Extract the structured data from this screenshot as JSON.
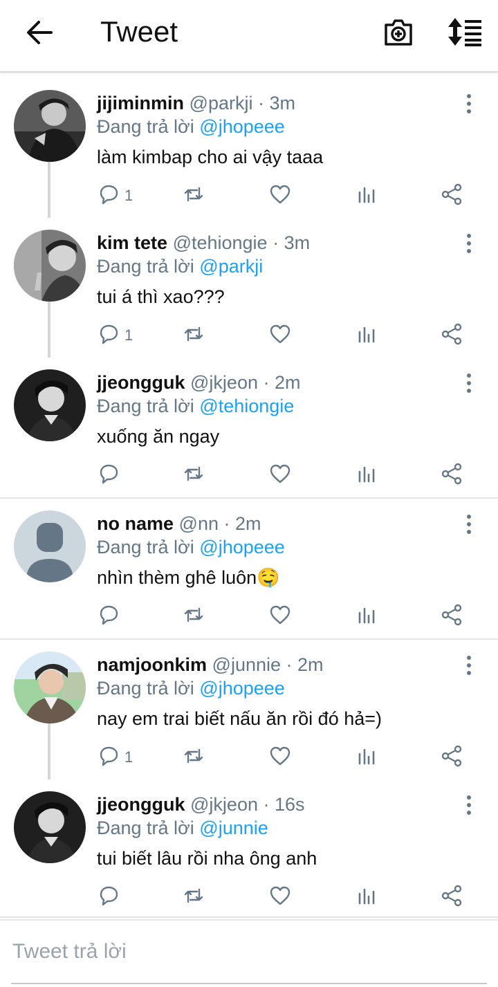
{
  "header": {
    "title": "Tweet"
  },
  "tweets": [
    {
      "name": "jijiminmin",
      "handle": "@parkji",
      "time": "· 3m",
      "replying_prefix": "Đang trả lời",
      "replying_to": "@jhopeee",
      "text": "làm kimbap cho ai vậy taaa",
      "reply_count": "1",
      "avatar": "photo-dark"
    },
    {
      "name": "kim tete",
      "handle": "@tehiongie",
      "time": "· 3m",
      "replying_prefix": "Đang trả lời",
      "replying_to": "@parkji",
      "text": "tui á thì xao???",
      "reply_count": "1",
      "avatar": "photo-grey"
    },
    {
      "name": "jjeongguk",
      "handle": "@jkjeon",
      "time": "· 2m",
      "replying_prefix": "Đang trả lời",
      "replying_to": "@tehiongie",
      "text": "xuống ăn ngay",
      "reply_count": "",
      "avatar": "photo-bw"
    },
    {
      "name": "no name",
      "handle": "@nn",
      "time": "· 2m",
      "replying_prefix": "Đang trả lời",
      "replying_to": "@jhopeee",
      "text": "nhìn thèm ghê luôn🤤",
      "reply_count": "",
      "avatar": "default-person"
    },
    {
      "name": "namjoonkim",
      "handle": "@junnie",
      "time": "· 2m",
      "replying_prefix": "Đang trả lời",
      "replying_to": "@jhopeee",
      "text": "nay em trai biết nấu ăn rồi đó hả=)",
      "reply_count": "1",
      "avatar": "photo-color"
    },
    {
      "name": "jjeongguk",
      "handle": "@jkjeon",
      "time": "· 16s",
      "replying_prefix": "Đang trả lời",
      "replying_to": "@junnie",
      "text": "tui biết lâu rồi nha ông anh",
      "reply_count": "",
      "avatar": "photo-bw"
    }
  ],
  "compose": {
    "placeholder": "Tweet trả lời"
  },
  "icons": {
    "back": "arrow-left-icon",
    "camera": "camera-add-icon",
    "sort": "sort-icon",
    "more": "more-vertical-icon",
    "reply": "reply-icon",
    "retweet": "retweet-icon",
    "like": "heart-icon",
    "stats": "stats-icon",
    "share": "share-icon"
  },
  "colors": {
    "mention": "#1da1f2",
    "secondary_text": "#657786",
    "icon": "#657786"
  }
}
